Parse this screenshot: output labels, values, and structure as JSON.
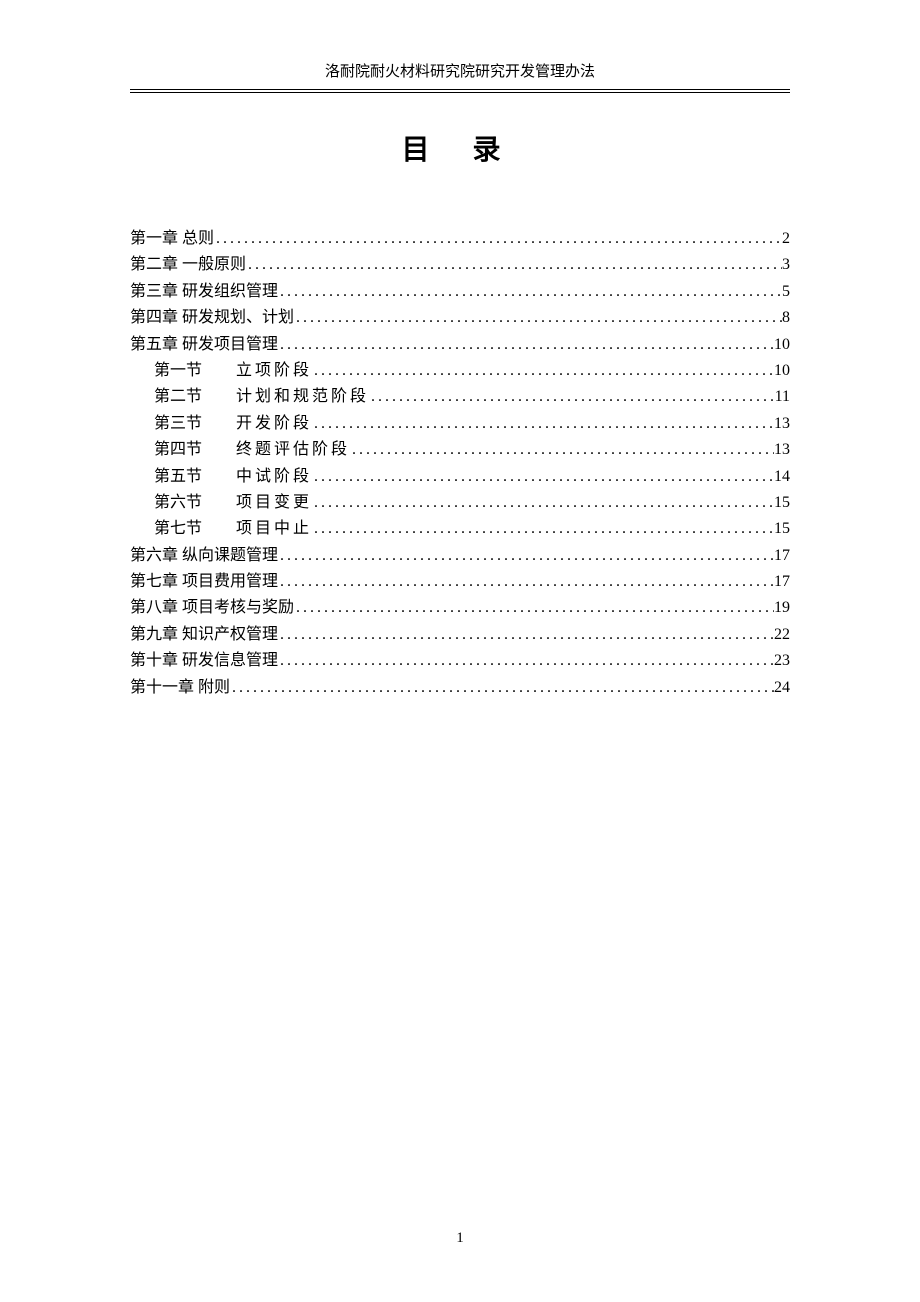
{
  "header": "洛耐院耐火材料研究院研究开发管理办法",
  "title": "目 录",
  "toc": {
    "chapters": [
      {
        "label": "第一章 总则",
        "page": "2"
      },
      {
        "label": "第二章 一般原则",
        "page": "3"
      },
      {
        "label": "第三章 研发组织管理",
        "page": "5"
      },
      {
        "label": "第四章 研发规划、计划",
        "page": "8"
      },
      {
        "label": "第五章 研发项目管理",
        "page": "10",
        "sections": [
          {
            "label": "第一节",
            "text": "立项阶段",
            "page": "10"
          },
          {
            "label": "第二节",
            "text": "计划和规范阶段",
            "page": "11"
          },
          {
            "label": "第三节",
            "text": "开发阶段",
            "page": "13"
          },
          {
            "label": "第四节",
            "text": "终题评估阶段",
            "page": "13"
          },
          {
            "label": "第五节",
            "text": "中试阶段",
            "page": "14"
          },
          {
            "label": "第六节",
            "text": "项目变更",
            "page": "15"
          },
          {
            "label": "第七节",
            "text": "项目中止",
            "page": "15"
          }
        ]
      },
      {
        "label": "第六章 纵向课题管理",
        "page": "17"
      },
      {
        "label": "第七章 项目费用管理",
        "page": "17"
      },
      {
        "label": "第八章 项目考核与奖励",
        "page": "19"
      },
      {
        "label": "第九章 知识产权管理",
        "page": "22"
      },
      {
        "label": "第十章 研发信息管理",
        "page": "23"
      },
      {
        "label": "第十一章 附则",
        "page": "24"
      }
    ]
  },
  "pageNumber": "1"
}
